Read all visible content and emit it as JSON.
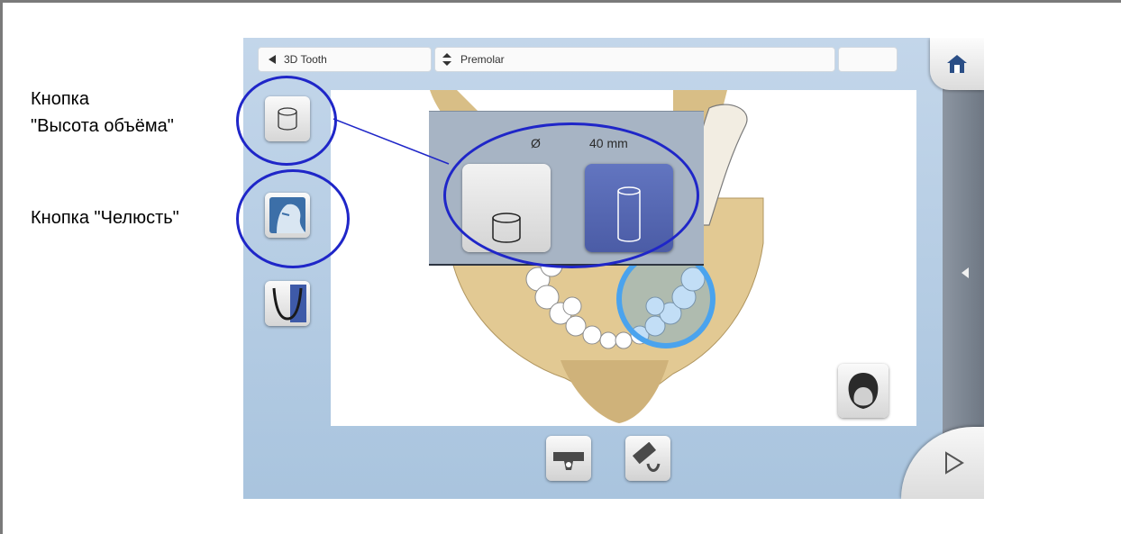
{
  "callouts": {
    "volume_height_line1": "Кнопка",
    "volume_height_line2": "\"Высота объёма\"",
    "jaw": "Кнопка \"Челюсть\""
  },
  "topbar": {
    "mode_label": "3D Tooth",
    "region_label": "Premolar"
  },
  "popup": {
    "diameter_symbol": "Ø",
    "size_value": "40 mm"
  },
  "icons": {
    "back": "left-triangle-icon",
    "region_sort": "up-down-arrows-icon",
    "home": "home-icon",
    "next": "right-triangle-icon",
    "rail_collapse": "left-triangle-icon",
    "volume_height": "cylinder-icon",
    "jaw": "face-profile-icon",
    "arch": "dental-arch-icon",
    "head_view": "head-silhouette-icon"
  },
  "colors": {
    "callout_ring": "#1f26c8",
    "selection_circle": "#4aa3ee",
    "selected_button": "#5466b4",
    "screen_background": "#b8cde3"
  }
}
